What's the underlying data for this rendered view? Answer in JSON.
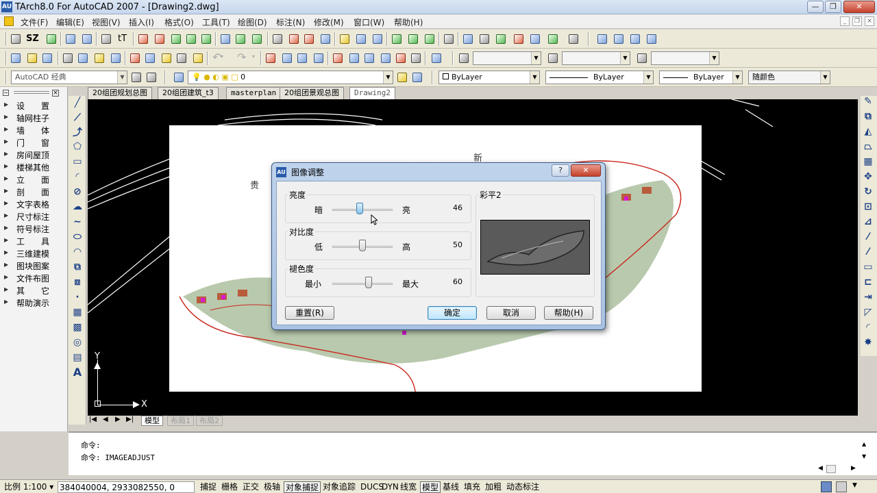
{
  "app": {
    "title": "TArch8.0 For AutoCAD 2007 - [Drawing2.dwg]",
    "icon_label": "AU"
  },
  "window_controls": {
    "minimize": "—",
    "restore": "❐",
    "close": "✕"
  },
  "menu": [
    "文件(F)",
    "编辑(E)",
    "视图(V)",
    "插入(I)",
    "格式(O)",
    "工具(T)",
    "绘图(D)",
    "标注(N)",
    "修改(M)",
    "窗口(W)",
    "帮助(H)"
  ],
  "toolbar1": {
    "sz_label": "SZ",
    "tt_label": "tT"
  },
  "toolbar3": {
    "workspace": "AutoCAD 经典",
    "layer": "0",
    "color": "ByLayer",
    "linetype": "ByLayer",
    "lineweight": "ByLayer",
    "plotstyle": "随颜色"
  },
  "left_panel": {
    "items": [
      "设　　置",
      "轴网柱子",
      "墙　　体",
      "门　　窗",
      "房间屋顶",
      "楼梯其他",
      "立　　面",
      "剖　　面",
      "文字表格",
      "尺寸标注",
      "符号标注",
      "工　　具",
      "三维建模",
      "图块图案",
      "文件布图",
      "其　　它",
      "帮助演示"
    ]
  },
  "doc_tabs": [
    "20组团规划总图",
    "20组团建筑_t3",
    "masterplan",
    "20组团景观总图",
    "Drawing2"
  ],
  "active_doc_tab": "Drawing2",
  "canvas": {
    "labels": {
      "new": "新",
      "gui": "贵"
    },
    "ucs_x": "X",
    "ucs_y": "Y"
  },
  "layout_tabs": [
    "模型",
    "布局1",
    "布局2"
  ],
  "dialog": {
    "title": "图像调整",
    "help_glyph": "?",
    "close_glyph": "✕",
    "brightness": {
      "label": "亮度",
      "low": "暗",
      "high": "亮",
      "value": 46
    },
    "contrast": {
      "label": "对比度",
      "low": "低",
      "high": "高",
      "value": 50
    },
    "fade": {
      "label": "褪色度",
      "low": "最小",
      "high": "最大",
      "value": 60
    },
    "preview_label": "彩平2",
    "buttons": {
      "reset": "重置(R)",
      "ok": "确定",
      "cancel": "取消",
      "help": "帮助(H)"
    }
  },
  "command": {
    "line1": "命令:",
    "line2": "命令: IMAGEADJUST"
  },
  "status": {
    "scale": "比例 1:100 ▾",
    "coords": "384040004, 2933082550, 0",
    "toggles": [
      {
        "label": "捕捉",
        "on": false
      },
      {
        "label": "栅格",
        "on": false
      },
      {
        "label": "正交",
        "on": false
      },
      {
        "label": "极轴",
        "on": false
      },
      {
        "label": "对象捕捉",
        "on": true
      },
      {
        "label": "对象追踪",
        "on": false
      },
      {
        "label": "DUCS",
        "on": false
      },
      {
        "label": "DYN",
        "on": false
      },
      {
        "label": "线宽",
        "on": false
      },
      {
        "label": "模型",
        "on": true
      },
      {
        "label": "基线",
        "on": false
      },
      {
        "label": "填充",
        "on": false
      },
      {
        "label": "加粗",
        "on": false
      },
      {
        "label": "动态标注",
        "on": false
      }
    ]
  },
  "colors": {
    "titlebar": "#c6d6ec",
    "canvas_bg": "#000000",
    "paper": "#ffffff",
    "site_line": "#c8281e",
    "accent_blue": "#2a5caa"
  }
}
